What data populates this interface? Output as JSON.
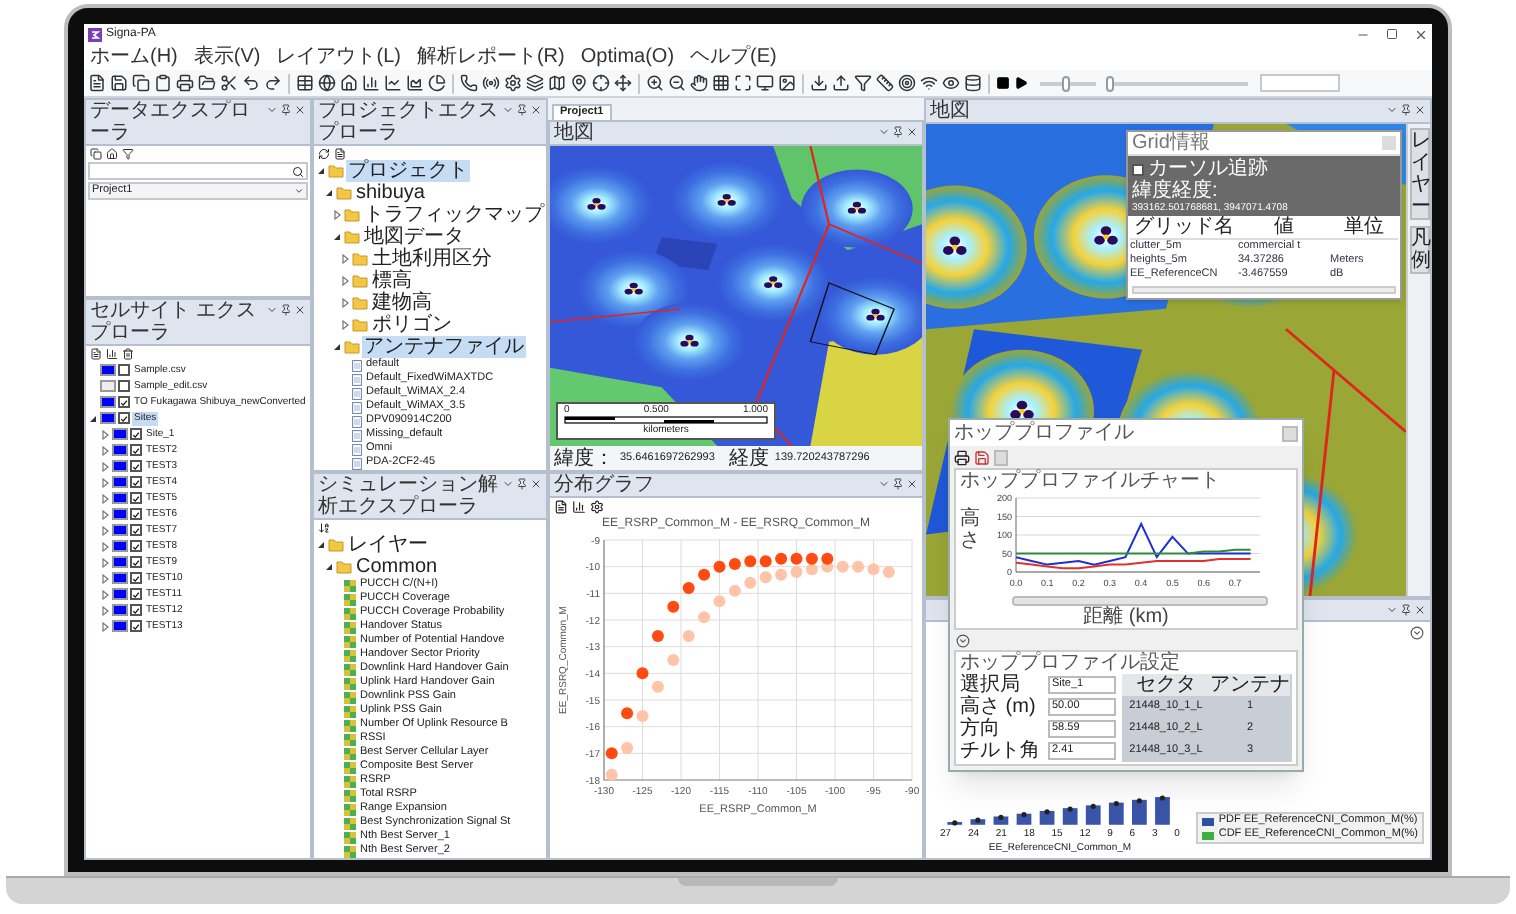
{
  "window": {
    "title": "Signa-PA"
  },
  "menu": [
    "ホーム(H)",
    "表示(V)",
    "レイアウト(L)",
    "解析レポート(R)",
    "Optima(O)",
    "ヘルプ(E)"
  ],
  "toolbar": {
    "sliders": [
      {
        "level": 0.45
      },
      {
        "level": 0.02
      }
    ]
  },
  "data_explorer": {
    "title": "データエクスプローラ",
    "dropdown": {
      "value": "Project1"
    }
  },
  "cell_site_explorer": {
    "title": "セルサイト エクスプローラ",
    "items": [
      {
        "label": "Sample.csv",
        "color": "#0000ff",
        "checked": false,
        "selected": false
      },
      {
        "label": "Sample_edit.csv",
        "color": "#eeeeee",
        "checked": false,
        "selected": false
      },
      {
        "label": "TO Fukagawa Shibuya_newConverted",
        "color": "#0000ff",
        "checked": true,
        "selected": false
      },
      {
        "label": "Sites",
        "color": "#0000ff",
        "checked": true,
        "selected": true,
        "expanded": true,
        "children": [
          {
            "label": "Site_1",
            "color": "#0000ff",
            "checked": true,
            "selected": false,
            "expanded": false
          },
          {
            "label": "TEST2",
            "color": "#0000ff",
            "checked": true,
            "selected": false,
            "expanded": false
          },
          {
            "label": "TEST3",
            "color": "#0000ff",
            "checked": true,
            "selected": false,
            "expanded": false
          },
          {
            "label": "TEST4",
            "color": "#0000ff",
            "checked": true,
            "selected": false,
            "expanded": false
          },
          {
            "label": "TEST5",
            "color": "#0000ff",
            "checked": true,
            "selected": false,
            "expanded": false
          },
          {
            "label": "TEST6",
            "color": "#0000ff",
            "checked": true,
            "selected": false,
            "expanded": false
          },
          {
            "label": "TEST7",
            "color": "#0000ff",
            "checked": true,
            "selected": false,
            "expanded": false
          },
          {
            "label": "TEST8",
            "color": "#0000ff",
            "checked": true,
            "selected": false,
            "expanded": false
          },
          {
            "label": "TEST9",
            "color": "#0000ff",
            "checked": true,
            "selected": false,
            "expanded": false
          },
          {
            "label": "TEST10",
            "color": "#0000ff",
            "checked": true,
            "selected": false,
            "expanded": false
          },
          {
            "label": "TEST11",
            "color": "#0000ff",
            "checked": true,
            "selected": false,
            "expanded": false
          },
          {
            "label": "TEST12",
            "color": "#0000ff",
            "checked": true,
            "selected": false,
            "expanded": false
          },
          {
            "label": "TEST13",
            "color": "#0000ff",
            "checked": true,
            "selected": false,
            "expanded": false
          }
        ]
      }
    ]
  },
  "project_explorer": {
    "title": "プロジェクトエクスプローラ",
    "tree": [
      {
        "label": "プロジェクト",
        "kind": "folder",
        "expanded": true,
        "selected": true,
        "children": [
          {
            "label": "shibuya",
            "kind": "folder",
            "expanded": true,
            "selected": false,
            "children": [
              {
                "label": "トラフィックマップ",
                "kind": "folder",
                "expanded": false,
                "selected": false
              },
              {
                "label": "地図データ",
                "kind": "folder",
                "expanded": true,
                "selected": false,
                "children": [
                  {
                    "label": "土地利用区分",
                    "kind": "folder",
                    "expanded": false,
                    "selected": false
                  },
                  {
                    "label": "標高",
                    "kind": "folder",
                    "expanded": false,
                    "selected": false
                  },
                  {
                    "label": "建物高",
                    "kind": "folder",
                    "expanded": false,
                    "selected": false
                  },
                  {
                    "label": "ポリゴン",
                    "kind": "folder",
                    "expanded": false,
                    "selected": false
                  }
                ]
              },
              {
                "label": "アンテナファイル",
                "kind": "folder",
                "expanded": true,
                "selected": true,
                "children": [
                  {
                    "label": "default",
                    "kind": "file",
                    "selected": false
                  },
                  {
                    "label": "Default_FixedWiMAXTDC",
                    "kind": "file",
                    "selected": false
                  },
                  {
                    "label": "Default_WiMAX_2.4",
                    "kind": "file",
                    "selected": false
                  },
                  {
                    "label": "Default_WiMAX_3.5",
                    "kind": "file",
                    "selected": false
                  },
                  {
                    "label": "DPV090914C200",
                    "kind": "file",
                    "selected": false
                  },
                  {
                    "label": "Missing_default",
                    "kind": "file",
                    "selected": false
                  },
                  {
                    "label": "Omni",
                    "kind": "file",
                    "selected": false
                  },
                  {
                    "label": "PDA-2CF2-45",
                    "kind": "file",
                    "selected": false
                  }
                ]
              }
            ]
          }
        ]
      }
    ]
  },
  "simulation_explorer": {
    "title": "シミュレーション解析エクスプローラ",
    "tree": [
      {
        "label": "レイヤー",
        "kind": "folder",
        "expanded": true,
        "children": [
          {
            "label": "Common",
            "kind": "folder",
            "expanded": true,
            "children": [
              {
                "label": "PUCCH C/(N+I)",
                "kind": "layer"
              },
              {
                "label": "PUCCH Coverage",
                "kind": "layer"
              },
              {
                "label": "PUCCH Coverage Probability",
                "kind": "layer"
              },
              {
                "label": "Handover Status",
                "kind": "layer"
              },
              {
                "label": "Number of Potential Handove",
                "kind": "layer"
              },
              {
                "label": "Handover Sector Priority",
                "kind": "layer"
              },
              {
                "label": "Downlink Hard Handover Gain",
                "kind": "layer"
              },
              {
                "label": "Uplink Hard Handover Gain",
                "kind": "layer"
              },
              {
                "label": "Downlink PSS Gain",
                "kind": "layer"
              },
              {
                "label": "Uplink PSS Gain",
                "kind": "layer"
              },
              {
                "label": "Number Of Uplink Resource B",
                "kind": "layer"
              },
              {
                "label": "RSSI",
                "kind": "layer"
              },
              {
                "label": "Best Server Cellular Layer",
                "kind": "layer"
              },
              {
                "label": "Composite Best Server",
                "kind": "layer"
              },
              {
                "label": "RSRP",
                "kind": "layer"
              },
              {
                "label": "Total RSRP",
                "kind": "layer"
              },
              {
                "label": "Range Expansion",
                "kind": "layer"
              },
              {
                "label": "Best Synchronization Signal St",
                "kind": "layer"
              },
              {
                "label": "Nth Best Server_1",
                "kind": "layer"
              },
              {
                "label": "Nth Best Server_2",
                "kind": "layer"
              }
            ]
          }
        ]
      }
    ]
  },
  "document_tabs": [
    {
      "label": "Project1",
      "selected": true
    }
  ],
  "map": {
    "title": "地図",
    "scale": {
      "ticks": [
        "0",
        "0.500",
        "1.000"
      ],
      "unit": "kilometers"
    },
    "latitude_label": "緯度：",
    "latitude": "35.6461697262993",
    "longitude_label": "経度",
    "longitude": "139.720243787296"
  },
  "distribution_graph": {
    "title": "分布グラフ",
    "chart_data": {
      "type": "scatter",
      "title": "EE_RSRP_Common_M - EE_RSRQ_Common_M",
      "xlabel": "EE_RSRP_Common_M",
      "ylabel": "EE_RSRQ_Common_M",
      "x": [
        -129,
        -127,
        -125,
        -123,
        -121,
        -119,
        -117,
        -115,
        -113,
        -111,
        -109,
        -107,
        -105,
        -103,
        -101,
        -99,
        -97,
        -95,
        -93
      ],
      "series": [
        {
          "color": "#ffc4a8",
          "values": [
            -17.8,
            -16.8,
            -15.6,
            -14.5,
            -13.5,
            -12.6,
            -11.9,
            -11.3,
            -10.9,
            -10.6,
            -10.4,
            -10.3,
            -10.2,
            -10.1,
            -10,
            -10,
            -10,
            -10.1,
            -10.2
          ]
        },
        {
          "color": "#ff4a12",
          "values": [
            -17,
            -15.5,
            -14,
            -12.6,
            -11.5,
            -10.8,
            -10.3,
            -10,
            -9.9,
            -9.8,
            -9.8,
            -9.7,
            -9.7,
            -9.7,
            -9.7,
            null,
            null,
            null,
            null
          ]
        }
      ],
      "xlim": [
        -130,
        -90
      ],
      "ylim": [
        -18,
        -9
      ],
      "grid": true,
      "xticks": [
        -130,
        -125,
        -120,
        -115,
        -110,
        -105,
        -100,
        -95,
        -90
      ],
      "yticks": [
        -18,
        -17,
        -16,
        -15,
        -14,
        -13,
        -12,
        -11,
        -10,
        -9
      ]
    }
  },
  "map2": {
    "title": "地図",
    "side_tabs": [
      {
        "label": "レイヤー",
        "selected": false
      },
      {
        "label": "凡例",
        "selected": false
      }
    ]
  },
  "grid_info": {
    "title": "Grid情報",
    "cursor_tracking": {
      "label": "カーソル追跡",
      "checked": false
    },
    "coord_label": "緯度経度:",
    "coord_value": "393162.501768681, 3947071.4708",
    "columns": [
      "グリッド名",
      "値",
      "単位"
    ],
    "rows": [
      {
        "name": "clutter_5m",
        "value": "commercial t"
      },
      {
        "name": "heights_5m",
        "value": "34.37286",
        "unit": "Meters"
      },
      {
        "name": "EE_ReferenceCN",
        "value": "-3.467559",
        "unit": "dB"
      }
    ]
  },
  "hop_profile": {
    "title": "ホッププロファイル",
    "chart_data": {
      "type": "line",
      "title": "ホッププロファイルチャート",
      "xlabel": "距離 (km)",
      "ylabel": "高さ",
      "x": [
        0,
        0.05,
        0.1,
        0.15,
        0.2,
        0.25,
        0.3,
        0.35,
        0.4,
        0.45,
        0.5,
        0.55,
        0.6,
        0.65,
        0.7,
        0.75
      ],
      "series": [
        {
          "color": "#1f2fd0",
          "values": [
            40,
            30,
            20,
            25,
            30,
            20,
            30,
            40,
            130,
            40,
            95,
            50,
            50,
            50,
            50,
            50
          ]
        },
        {
          "color": "#e03030",
          "values": [
            25,
            20,
            15,
            10,
            10,
            15,
            20,
            20,
            25,
            30,
            30,
            30,
            30,
            35,
            35,
            35
          ]
        },
        {
          "color": "#2e8b3a",
          "values": [
            50,
            50,
            50,
            50,
            50,
            50,
            50,
            50,
            50,
            50,
            50,
            50,
            55,
            55,
            60,
            60
          ]
        }
      ],
      "xlim": [
        0,
        0.78
      ],
      "ylim": [
        0,
        200
      ],
      "grid": true,
      "xticks": [
        {
          "value": 0,
          "label": "0.0"
        },
        {
          "value": 0.1,
          "label": "0.1"
        },
        {
          "value": 0.2,
          "label": "0.2"
        },
        {
          "value": 0.3,
          "label": "0.3"
        },
        {
          "value": 0.4,
          "label": "0.4"
        },
        {
          "value": 0.5,
          "label": "0.5"
        },
        {
          "value": 0.6,
          "label": "0.6"
        },
        {
          "value": 0.7,
          "label": "0.7"
        }
      ],
      "yticks": [
        0,
        50,
        100,
        150,
        200
      ]
    },
    "settings_title": "ホッププロファイル設定",
    "fields": [
      {
        "label": "選択局",
        "value": "Site_1"
      },
      {
        "label": "高さ (m)",
        "value": "50.00"
      },
      {
        "label": "方向",
        "value": "58.59"
      },
      {
        "label": "チルト角",
        "value": "2.41"
      }
    ],
    "table": {
      "columns": [
        "セクタ",
        "アンテナ"
      ],
      "rows": [
        [
          "21448_10_1_L",
          "1"
        ],
        [
          "21448_10_2_L",
          "2"
        ],
        [
          "21448_10_3_L",
          "3"
        ]
      ]
    }
  },
  "histogram": {
    "ticks": [
      "27",
      "24",
      "21",
      "18",
      "15",
      "12",
      "9",
      "6",
      "3",
      "0"
    ],
    "xlabel": "EE_ReferenceCNI_Common_M",
    "legend": [
      {
        "label": "PDF EE_ReferenceCNI_Common_M(%)",
        "color": "#2f4fa0"
      },
      {
        "label": "CDF EE_ReferenceCNI_Common_M(%)",
        "color": "#3cb043"
      }
    ]
  }
}
